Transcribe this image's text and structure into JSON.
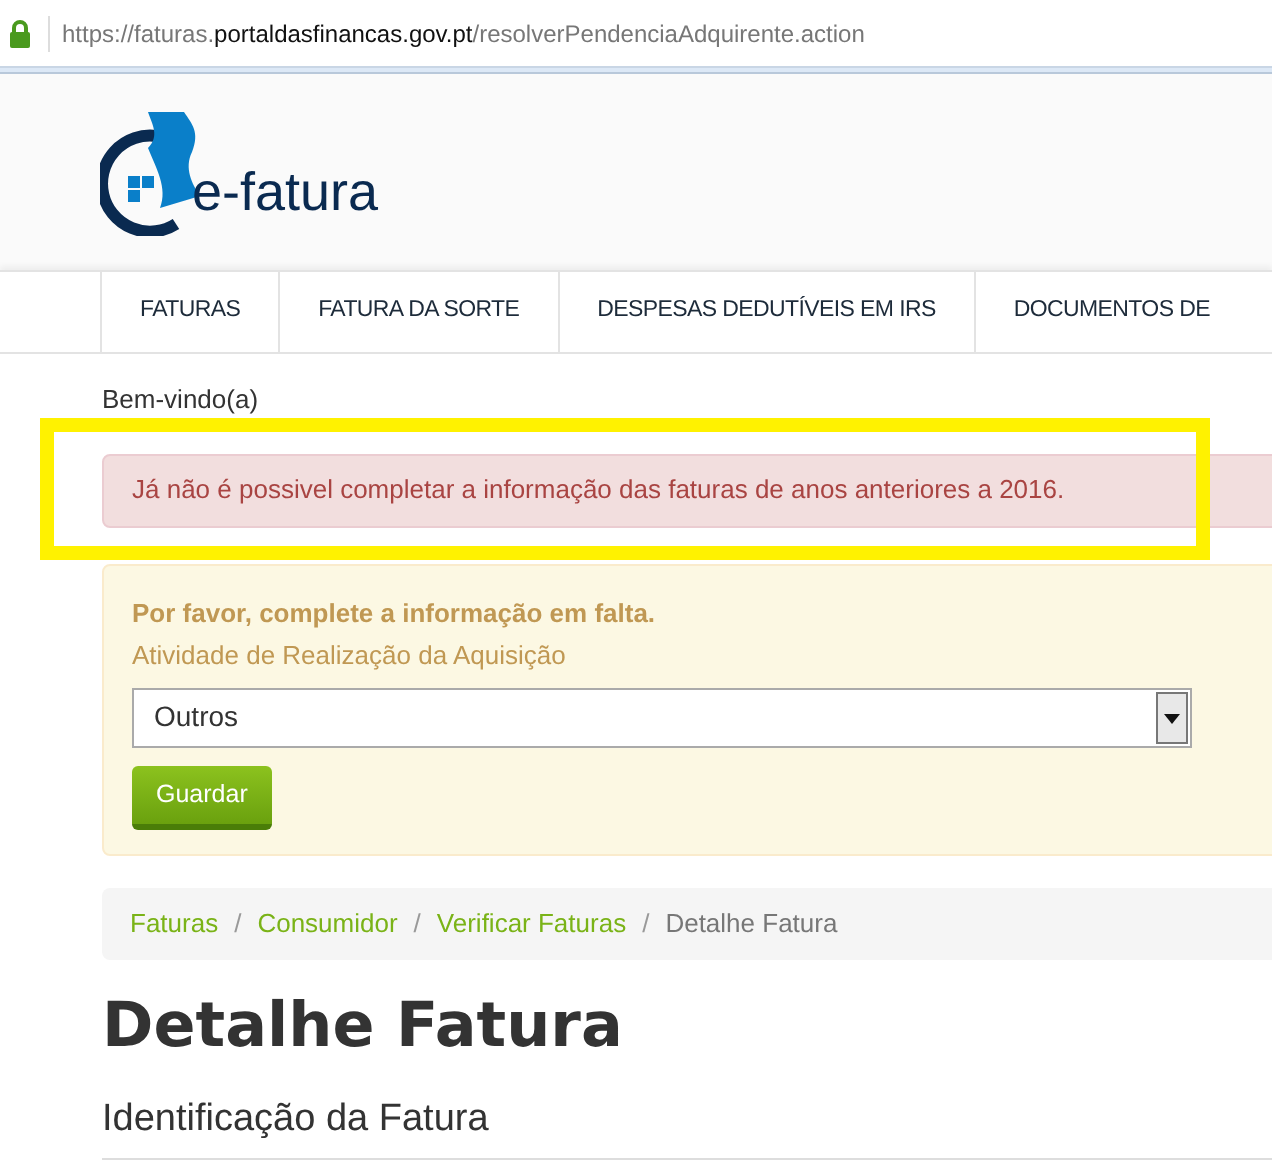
{
  "address_bar": {
    "scheme_host": "https://faturas.",
    "domain": "portaldasfinancas.gov.pt",
    "path": "/resolverPendenciaAdquirente.action"
  },
  "logo": {
    "text": "e-fatura"
  },
  "nav": {
    "items": [
      {
        "label": "FATURAS"
      },
      {
        "label": "FATURA DA SORTE"
      },
      {
        "label": "DESPESAS DEDUTÍVEIS EM IRS"
      },
      {
        "label": "DOCUMENTOS DE"
      }
    ]
  },
  "welcome": "Bem-vindo(a)",
  "error_alert": {
    "text": "Já não é possivel completar a informação das faturas de anos anteriores a 2016.",
    "highlighted": true
  },
  "form_panel": {
    "heading": "Por favor, complete a informação em falta.",
    "field_label": "Atividade de Realização da Aquisição",
    "select_value": "Outros",
    "button": "Guardar"
  },
  "breadcrumb": {
    "separator": "/",
    "items": [
      {
        "label": "Faturas",
        "kind": "link"
      },
      {
        "label": "Consumidor",
        "kind": "link"
      },
      {
        "label": "Verificar Faturas",
        "kind": "link"
      },
      {
        "label": "Detalhe Fatura",
        "kind": "current"
      }
    ]
  },
  "page_title": "Detalhe Fatura",
  "section_title": "Identificação da Fatura"
}
